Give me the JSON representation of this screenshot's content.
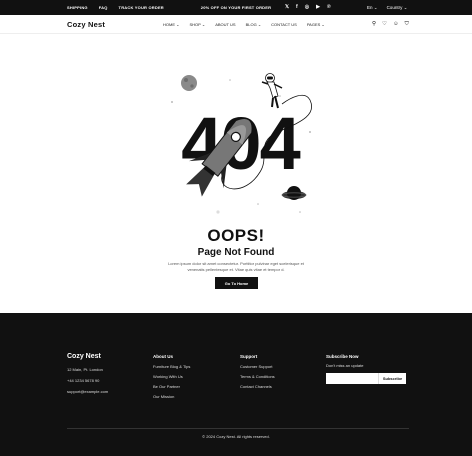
{
  "topbar": {
    "links": [
      "SHIPPING",
      "FAQ",
      "TRACK YOUR ORDER"
    ],
    "promo": "20% OFF ON YOUR FIRST ORDER",
    "social_icons": [
      "x-icon",
      "facebook-icon",
      "instagram-icon",
      "youtube-icon",
      "pinterest-icon"
    ],
    "language": "En",
    "country": "Country"
  },
  "header": {
    "logo": "Cozy Nest",
    "nav": [
      "HOME",
      "SHOP",
      "ABOUT US",
      "BLOG",
      "CONTACT US",
      "PAGES"
    ],
    "icons": [
      "search-icon",
      "heart-icon",
      "user-icon",
      "bag-icon"
    ]
  },
  "error": {
    "code": "404",
    "title": "OOPS!",
    "subtitle": "Page Not Found",
    "description": "Lorem ipsum dolor sit amet consectetur. Porttitor pulvinar eget scelerisque et venenatis pellentesque et. Vitae quis vitae et tempor d.",
    "button": "Go To Home"
  },
  "footer": {
    "logo": "Cozy Nest",
    "contact": [
      "12 Main, Pt. London",
      "+44 1234 5678 90",
      "support@example.com"
    ],
    "about": {
      "heading": "About Us",
      "items": [
        "Furniture Blog & Tips",
        "Working With Us",
        "Be Our Partner",
        "Our Mission"
      ]
    },
    "support": {
      "heading": "Support",
      "items": [
        "Customer Support",
        "Terms & Conditions",
        "Contact Channels"
      ]
    },
    "subscribe": {
      "heading": "Subscribe Now",
      "note": "Don't miss an update",
      "placeholder": "",
      "button": "Subscribe"
    },
    "copyright": "© 2024 Cozy Nest. All rights reserved."
  }
}
